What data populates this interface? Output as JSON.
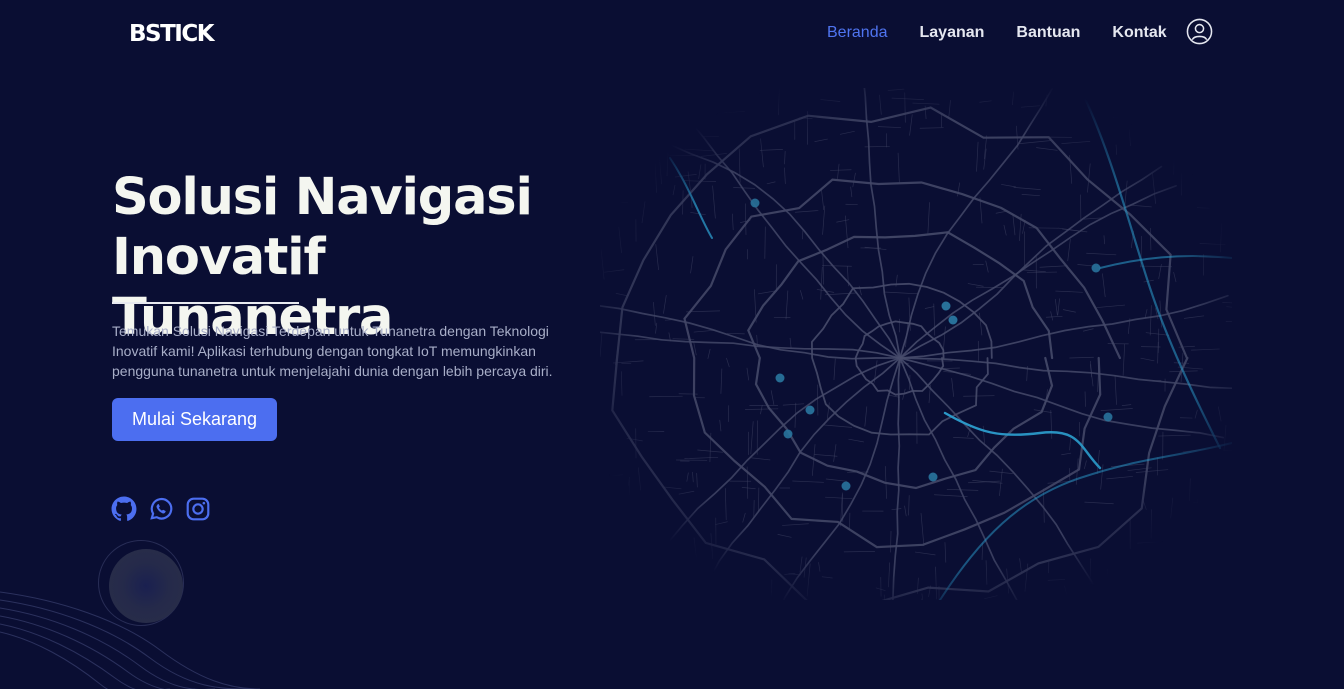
{
  "brand": {
    "logo": "BSTICK"
  },
  "nav": {
    "items": [
      {
        "label": "Beranda",
        "active": true
      },
      {
        "label": "Layanan",
        "active": false
      },
      {
        "label": "Bantuan",
        "active": false
      },
      {
        "label": "Kontak",
        "active": false
      }
    ],
    "profile_icon": "user-circle-icon"
  },
  "hero": {
    "title_line1": "Solusi Navigasi",
    "title_line2": "Inovatif Tunanetra",
    "description": "Temukan Solusi Navigasi Terdepan untuk Tunanetra dengan Teknologi Inovatif kami! Aplikasi terhubung dengan tongkat IoT memungkinkan pengguna tunanetra untuk menjelajahi dunia dengan lebih percaya diri.",
    "cta_label": "Mulai Sekarang"
  },
  "socials": [
    "github-icon",
    "whatsapp-icon",
    "instagram-icon"
  ],
  "colors": {
    "background": "#0a0e33",
    "accent": "#4c6ef0",
    "nav_active": "#4f74f0",
    "map_roads": "#4a4f6e",
    "map_highlight": "#2ea8d8"
  }
}
